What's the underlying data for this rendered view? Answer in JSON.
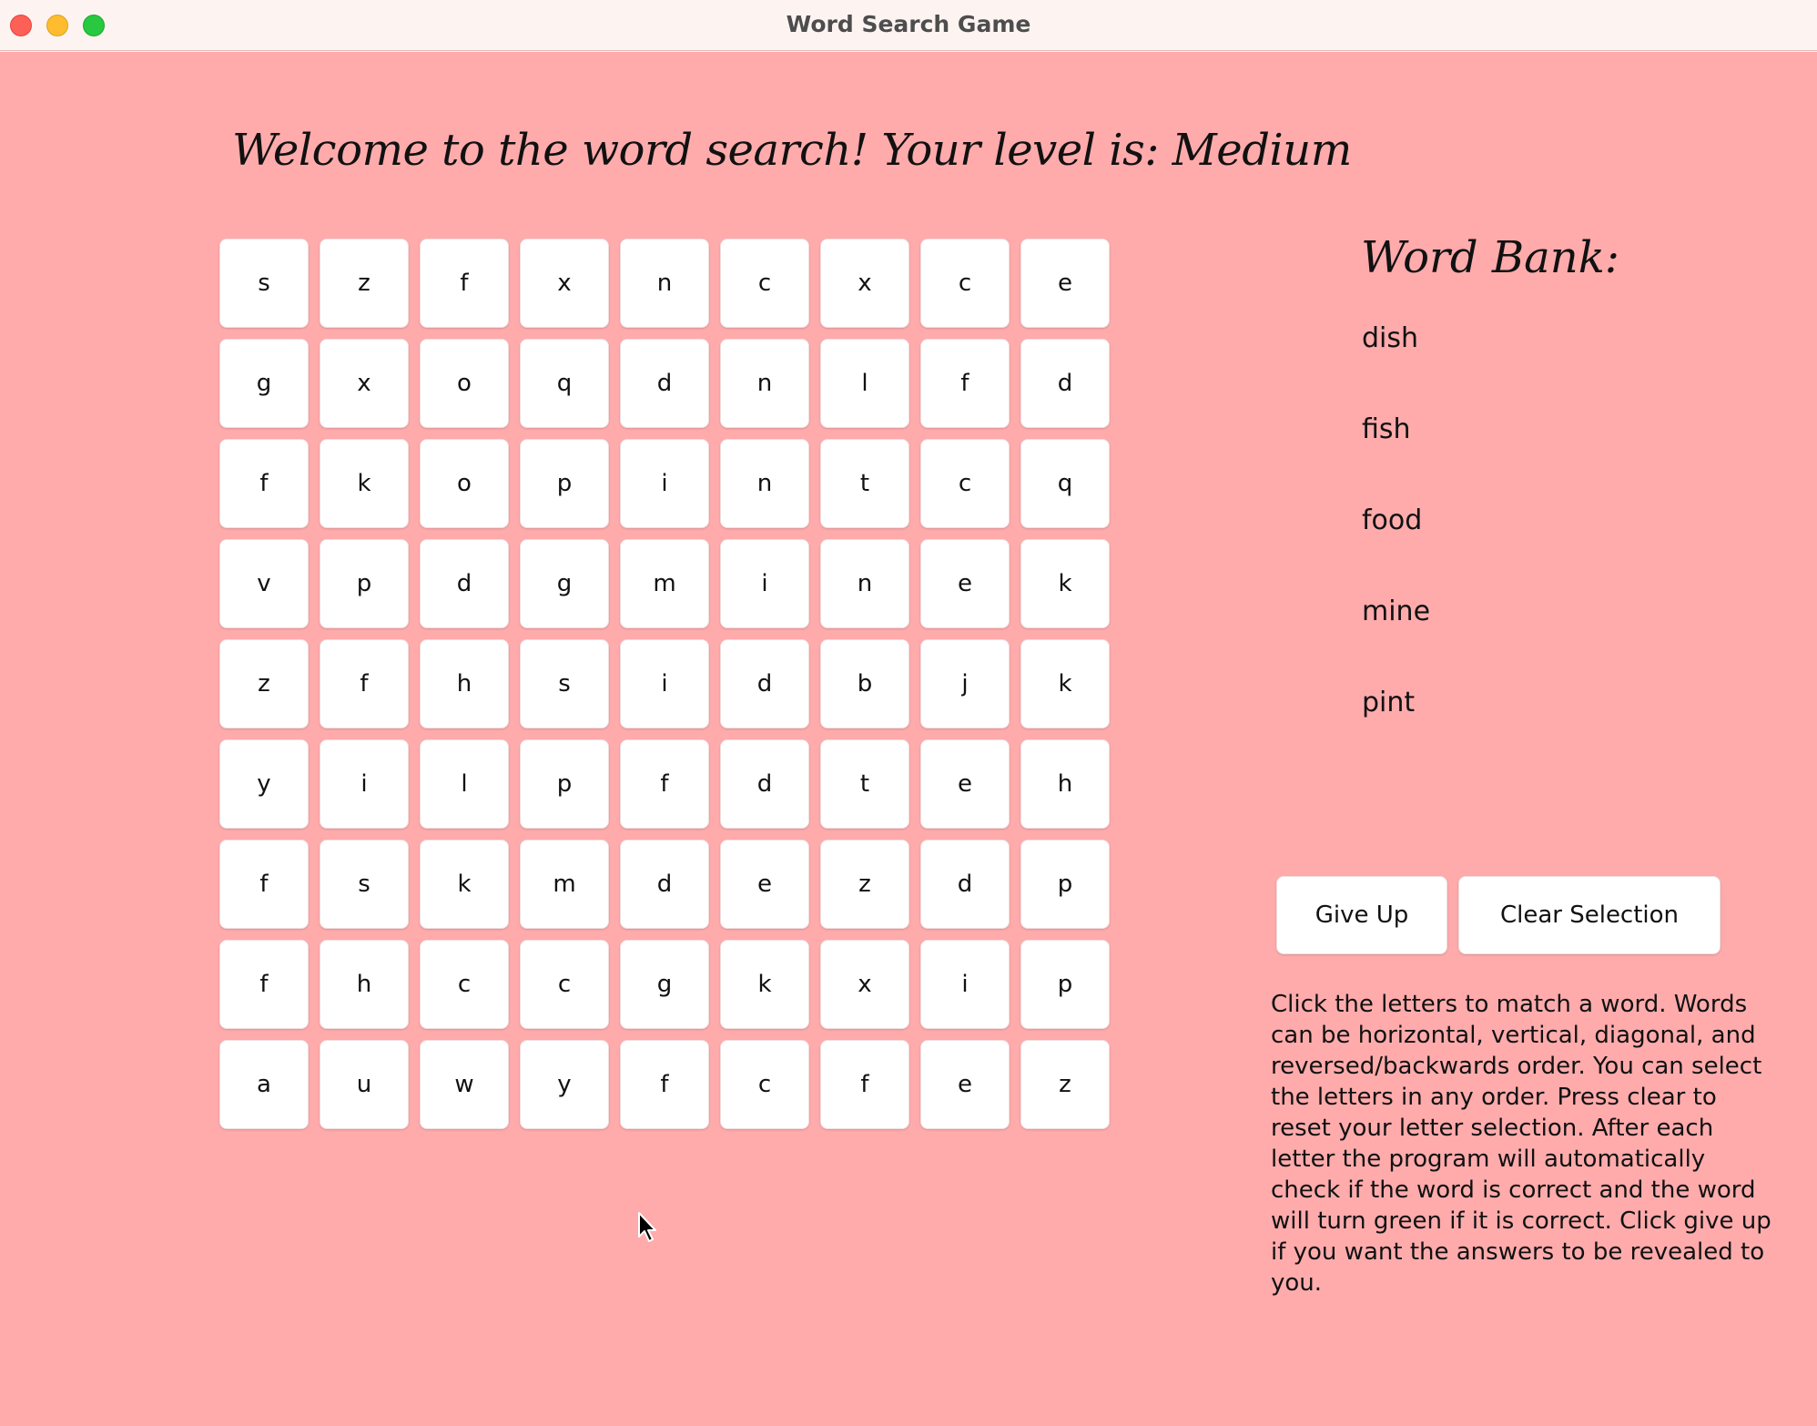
{
  "window": {
    "title": "Word Search Game",
    "background_color": "#ffabac"
  },
  "header": {
    "welcome": "Welcome to the word search! Your level is: Medium"
  },
  "grid": {
    "rows": [
      [
        "s",
        "z",
        "f",
        "x",
        "n",
        "c",
        "x",
        "c",
        "e"
      ],
      [
        "g",
        "x",
        "o",
        "q",
        "d",
        "n",
        "l",
        "f",
        "d"
      ],
      [
        "f",
        "k",
        "o",
        "p",
        "i",
        "n",
        "t",
        "c",
        "q"
      ],
      [
        "v",
        "p",
        "d",
        "g",
        "m",
        "i",
        "n",
        "e",
        "k"
      ],
      [
        "z",
        "f",
        "h",
        "s",
        "i",
        "d",
        "b",
        "j",
        "k"
      ],
      [
        "y",
        "i",
        "l",
        "p",
        "f",
        "d",
        "t",
        "e",
        "h"
      ],
      [
        "f",
        "s",
        "k",
        "m",
        "d",
        "e",
        "z",
        "d",
        "p"
      ],
      [
        "f",
        "h",
        "c",
        "c",
        "g",
        "k",
        "x",
        "i",
        "p"
      ],
      [
        "a",
        "u",
        "w",
        "y",
        "f",
        "c",
        "f",
        "e",
        "z"
      ]
    ]
  },
  "word_bank": {
    "title": "Word Bank:",
    "words": [
      "dish",
      "fish",
      "food",
      "mine",
      "pint"
    ]
  },
  "buttons": {
    "give_up": "Give Up",
    "clear_selection": "Clear Selection"
  },
  "instructions": "Click the letters to match a word. Words can be horizontal, vertical, diagonal, and reversed/backwards order. You can select the letters in any order. Press clear to reset your letter selection. After each letter the program will automatically check if the word is correct and the word will turn green if it is correct. Click give up if you want the answers to be revealed to you."
}
